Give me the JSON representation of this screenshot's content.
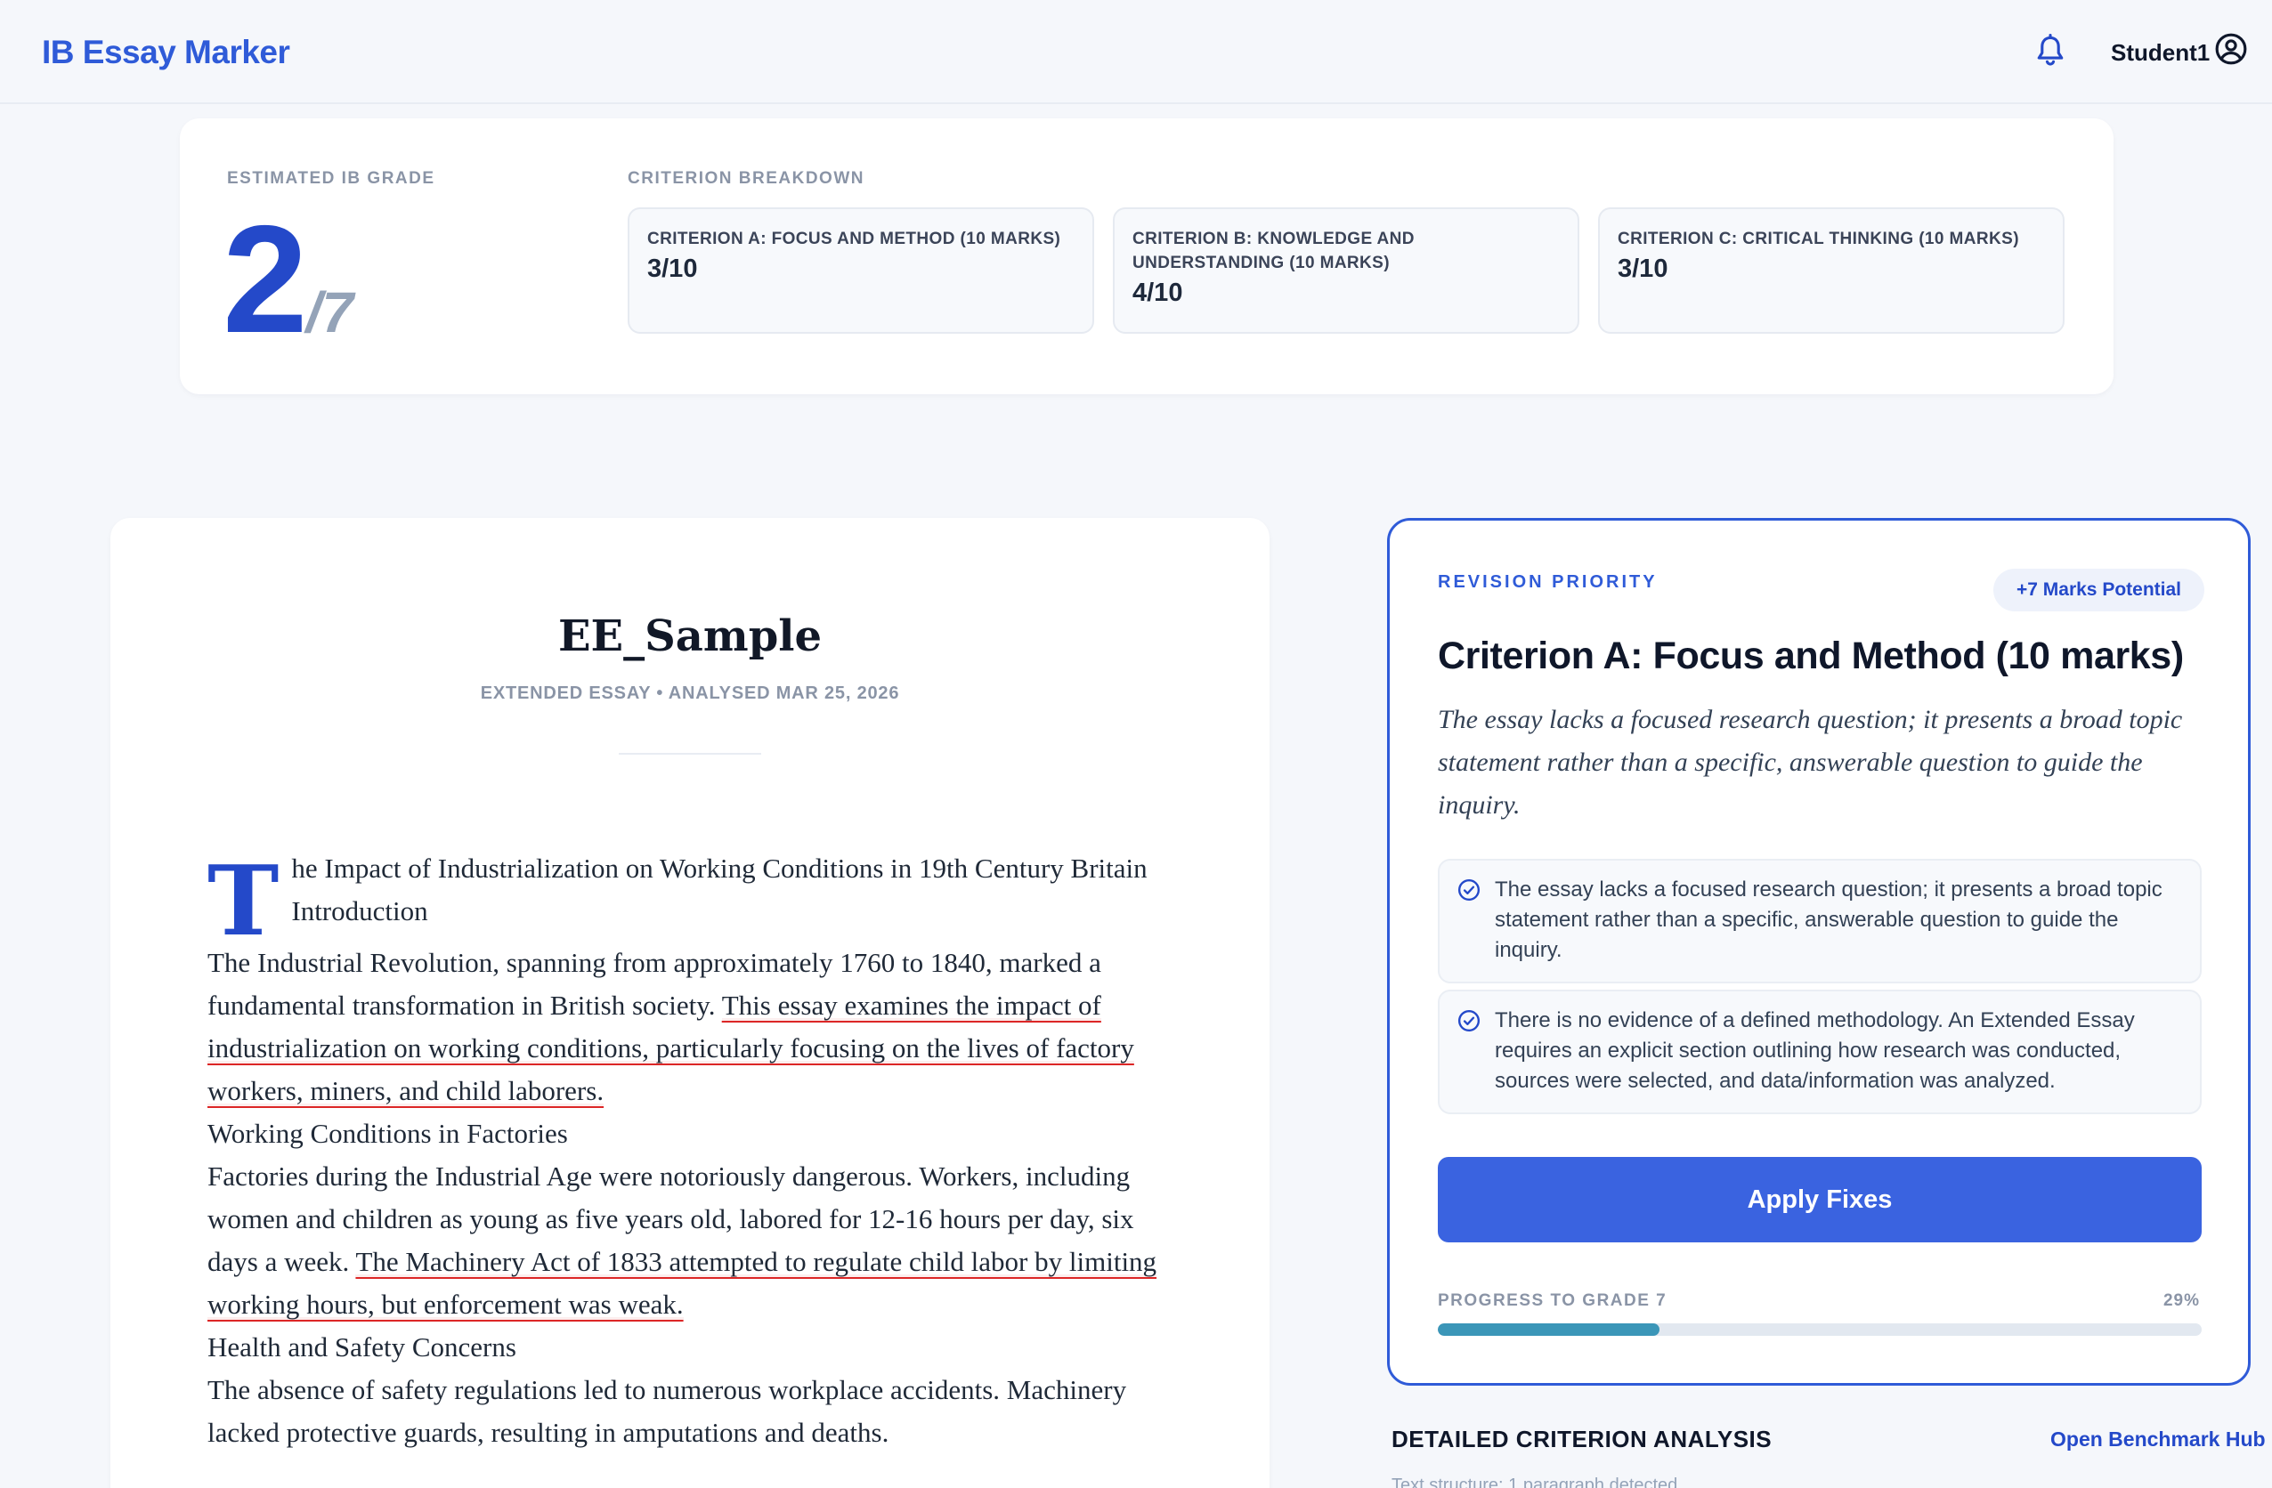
{
  "header": {
    "brand": "IB Essay Marker",
    "username": "Student1",
    "icons": [
      "bell-icon",
      "user-circle-icon"
    ]
  },
  "grade": {
    "label": "ESTIMATED IB GRADE",
    "value": "2",
    "out_of": "/7",
    "breakdown_label": "CRITERION BREAKDOWN",
    "criteria": [
      {
        "name": "CRITERION A: FOCUS AND METHOD (10 MARKS)",
        "score": "3/10"
      },
      {
        "name": "CRITERION B: KNOWLEDGE AND UNDERSTANDING (10 MARKS)",
        "score": "4/10"
      },
      {
        "name": "CRITERION C: CRITICAL THINKING (10 MARKS)",
        "score": "3/10"
      }
    ]
  },
  "essay": {
    "title": "EE_Sample",
    "meta": "EXTENDED ESSAY • ANALYSED MAR 25, 2026",
    "dropcap": "T",
    "heading_rest": "he Impact of Industrialization on Working Conditions in 19th Century Britain",
    "intro_heading": "Introduction",
    "p1_plain": "The Industrial Revolution, spanning from approximately 1760 to 1840, marked a fundamental transformation in British society. ",
    "p1_highlight": "This essay examines the impact of industrialization on working conditions, particularly focusing on the lives of factory workers, miners, and child laborers.",
    "h2": "Working Conditions in Factories",
    "p2_plain": "Factories during the Industrial Age were notoriously dangerous. Workers, including women and children as young as five years old, labored for 12-16 hours per day, six days a week. ",
    "p2_highlight": "The Machinery Act of 1833 attempted to regulate child labor by limiting working hours, but enforcement was weak.",
    "h3": "Health and Safety Concerns",
    "p3": "The absence of safety regulations led to numerous workplace accidents. Machinery lacked protective guards, resulting in amputations and deaths."
  },
  "revision": {
    "eyebrow": "REVISION PRIORITY",
    "pill": "+7 Marks Potential",
    "title": "Criterion A: Focus and Method (10 marks)",
    "quote": "The essay lacks a focused research question; it presents a broad topic statement rather than a specific, answerable question to guide the inquiry.",
    "issues": [
      "The essay lacks a focused research question; it presents a broad topic statement rather than a specific, answerable question to guide the inquiry.",
      "There is no evidence of a defined methodology. An Extended Essay requires an explicit section outlining how research was conducted, sources were selected, and data/information was analyzed."
    ],
    "apply_label": "Apply Fixes",
    "progress_label": "PROGRESS TO GRADE 7",
    "progress_text": "29%",
    "progress_value": 0.29,
    "accent": "#2f5bd8",
    "progress_color": "#3b96b8"
  },
  "detail": {
    "title": "DETAILED CRITERION ANALYSIS",
    "link": "Open Benchmark Hub",
    "sub": "Text structure: 1 paragraph detected"
  }
}
